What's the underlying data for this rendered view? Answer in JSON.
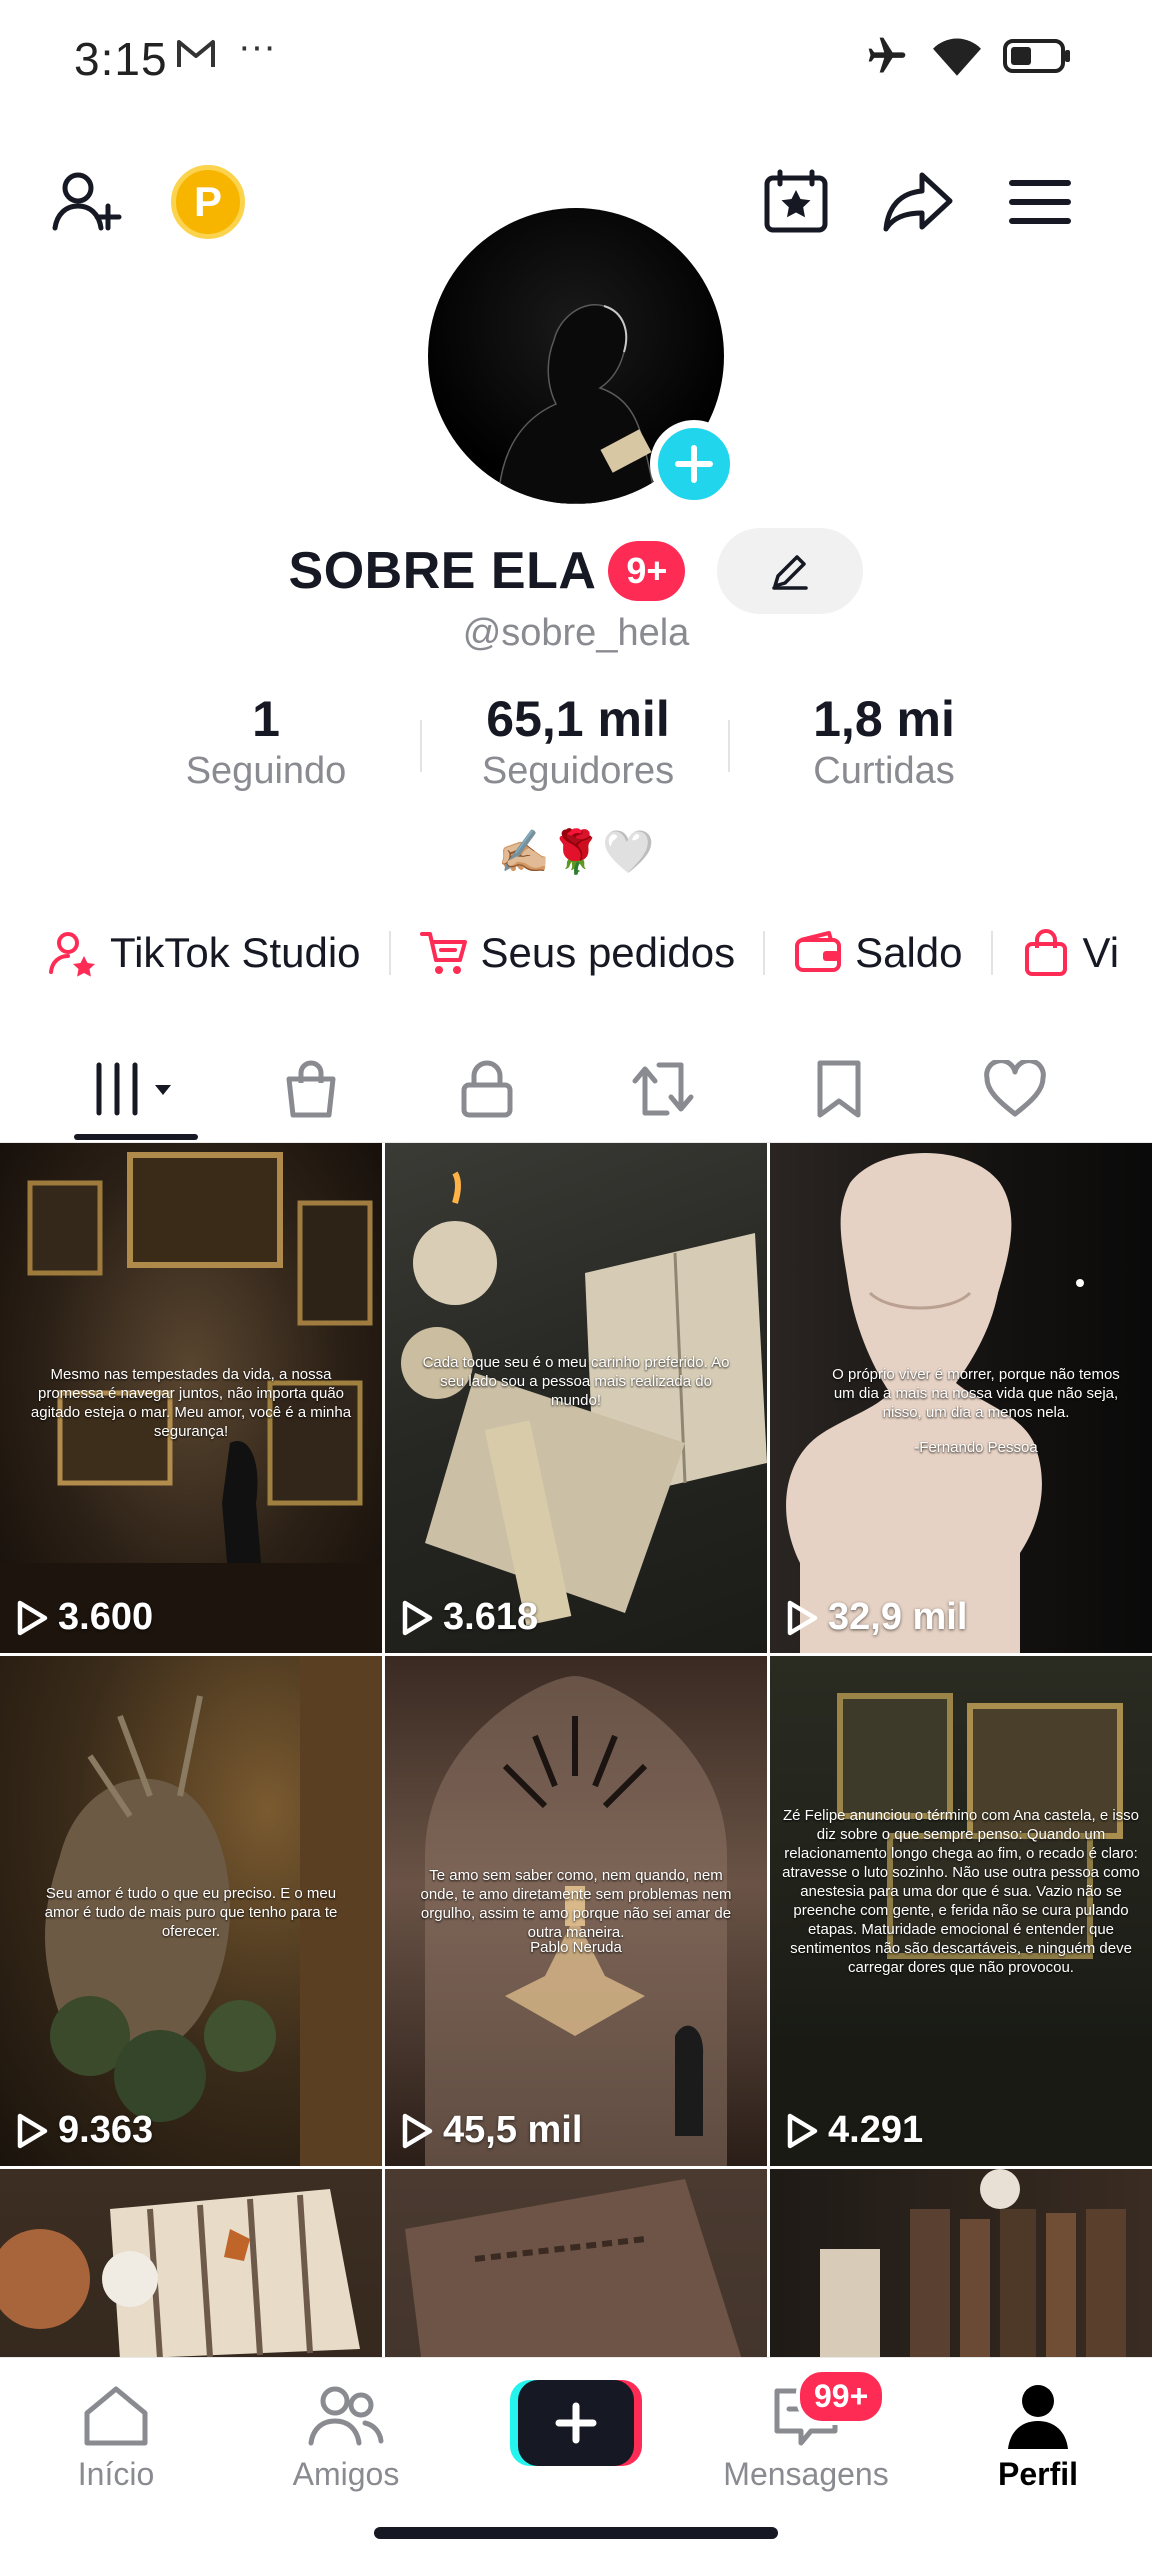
{
  "status_bar": {
    "time": "3:15",
    "more": "···"
  },
  "profile": {
    "name": "SOBRE ELA",
    "badge": "9+",
    "username": "@sobre_hela",
    "bio": "✍🏼🌹🤍",
    "stats": [
      {
        "value": "1",
        "label": "Seguindo"
      },
      {
        "value": "65,1 mil",
        "label": "Seguidores"
      },
      {
        "value": "1,8 mi",
        "label": "Curtidas"
      }
    ],
    "coin_label": "P"
  },
  "quick_links": [
    {
      "label": "TikTok Studio",
      "icon": "user-star-icon"
    },
    {
      "label": "Seus pedidos",
      "icon": "cart-icon"
    },
    {
      "label": "Saldo",
      "icon": "wallet-icon"
    },
    {
      "label": "Vi",
      "icon": "bag-icon"
    }
  ],
  "videos": [
    {
      "views": "3.600",
      "caption": "Mesmo nas tempestades da vida, a nossa promessa é navegar juntos, não importa quão agitado esteja o mar. Meu amor, você é a minha segurança!"
    },
    {
      "views": "3.618",
      "caption": "Cada toque seu é o meu carinho preferido. Ao seu lado sou a pessoa mais realizada do mundo!"
    },
    {
      "views": "32,9 mil",
      "caption": "O próprio viver é morrer, porque não temos um dia a mais na nossa vida que não seja, nisso, um dia a menos nela.",
      "author": "-Fernando Pessoa"
    },
    {
      "views": "9.363",
      "caption": "Seu amor é tudo o que eu preciso. E o meu amor é tudo de mais puro que tenho para te oferecer."
    },
    {
      "views": "45,5 mil",
      "caption": "Te amo sem saber como, nem quando, nem onde, te amo diretamente sem problemas nem orgulho, assim te amo porque não sei amar de outra maneira.",
      "author": "Pablo Neruda"
    },
    {
      "views": "4.291",
      "caption": "Zé Felipe anunciou o término com Ana castela, e isso diz sobre o que sempre penso: Quando um relacionamento longo chega ao fim, o recado é claro: atravesse o luto sozinho. Não use outra pessoa como anestesia para uma dor que é sua. Vazio não se preenche com gente, e ferida não se cura pulando etapas. Maturidade emocional é entender que sentimentos não são descartáveis, e ninguém deve carregar dores que não provocou."
    },
    {
      "views": "",
      "caption": ""
    },
    {
      "views": "",
      "caption": ""
    },
    {
      "views": "",
      "caption": ""
    }
  ],
  "nav": {
    "home": "Início",
    "friends": "Amigos",
    "messages": "Mensagens",
    "messages_badge": "99+",
    "profile": "Perfil"
  },
  "colors": {
    "accent": "#fe2c55",
    "add": "#20d5ec",
    "coin": "#f7b500"
  }
}
